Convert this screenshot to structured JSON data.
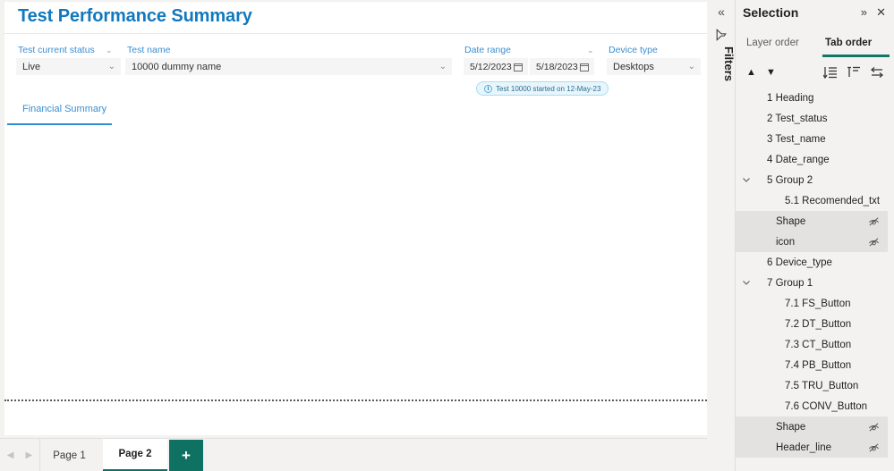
{
  "report": {
    "title": "Test Performance Summary",
    "slicers": {
      "status": {
        "label": "Test current status",
        "value": "Live"
      },
      "test_name": {
        "label": "Test name",
        "value": "10000 dummy name"
      },
      "date_range": {
        "label": "Date range",
        "start": "5/12/2023",
        "end": "5/18/2023"
      },
      "device_type": {
        "label": "Device type",
        "value": "Desktops"
      }
    },
    "info_badge": "Test 10000 started on 12-May-23",
    "nav_tab": "Financial Summary"
  },
  "page_tabs": {
    "items": [
      {
        "label": "Page 1",
        "active": false
      },
      {
        "label": "Page 2",
        "active": true
      }
    ],
    "add_label": "+"
  },
  "filters_rail": {
    "collapse_icon": "chevron-double-left-icon",
    "filter_icon": "filter-icon",
    "label": "Filters"
  },
  "selection": {
    "title": "Selection",
    "expand_icon": "chevron-double-right-icon",
    "close_icon": "close-icon",
    "tabs": {
      "layer_order": "Layer order",
      "tab_order": "Tab order"
    },
    "move_up_icon": "triangle-up-icon",
    "move_down_icon": "triangle-down-icon",
    "toolbar_icons": [
      "tab-order-list-icon",
      "tab-order-top-icon",
      "tab-order-swap-icon"
    ],
    "items": [
      {
        "label": "1 Heading",
        "level": 1,
        "shaded": false,
        "expander": null,
        "hidden_icon": false
      },
      {
        "label": "2 Test_status",
        "level": 1,
        "shaded": false,
        "expander": null,
        "hidden_icon": false
      },
      {
        "label": "3 Test_name",
        "level": 1,
        "shaded": false,
        "expander": null,
        "hidden_icon": false
      },
      {
        "label": "4 Date_range",
        "level": 1,
        "shaded": false,
        "expander": null,
        "hidden_icon": false
      },
      {
        "label": "5 Group 2",
        "level": 1,
        "shaded": false,
        "expander": "down",
        "hidden_icon": false
      },
      {
        "label": "5.1 Recomended_txt",
        "level": 2,
        "shaded": false,
        "expander": null,
        "hidden_icon": false
      },
      {
        "label": "Shape",
        "level": 2,
        "shaded": true,
        "expander": null,
        "hidden_icon": true
      },
      {
        "label": "icon",
        "level": 2,
        "shaded": true,
        "expander": null,
        "hidden_icon": true
      },
      {
        "label": "6 Device_type",
        "level": 1,
        "shaded": false,
        "expander": null,
        "hidden_icon": false
      },
      {
        "label": "7 Group 1",
        "level": 1,
        "shaded": false,
        "expander": "down",
        "hidden_icon": false
      },
      {
        "label": "7.1 FS_Button",
        "level": 2,
        "shaded": false,
        "expander": null,
        "hidden_icon": false
      },
      {
        "label": "7.2 DT_Button",
        "level": 2,
        "shaded": false,
        "expander": null,
        "hidden_icon": false
      },
      {
        "label": "7.3 CT_Button",
        "level": 2,
        "shaded": false,
        "expander": null,
        "hidden_icon": false
      },
      {
        "label": "7.4 PB_Button",
        "level": 2,
        "shaded": false,
        "expander": null,
        "hidden_icon": false
      },
      {
        "label": "7.5 TRU_Button",
        "level": 2,
        "shaded": false,
        "expander": null,
        "hidden_icon": false
      },
      {
        "label": "7.6 CONV_Button",
        "level": 2,
        "shaded": false,
        "expander": null,
        "hidden_icon": false
      },
      {
        "label": "Shape",
        "level": 2,
        "shaded": true,
        "expander": null,
        "hidden_icon": true
      },
      {
        "label": "Header_line",
        "level": 2,
        "shaded": true,
        "expander": null,
        "hidden_icon": true
      }
    ]
  },
  "colors": {
    "title_blue": "#1278be",
    "slicer_blue": "#3b8ed0",
    "teal": "#0f7162",
    "tab_order_underline": "#117865",
    "badge_bg": "#e8f6fc",
    "badge_border": "#a9ddf2",
    "pane_bg": "#f3f2f1",
    "row_shaded": "#e4e2e0"
  }
}
